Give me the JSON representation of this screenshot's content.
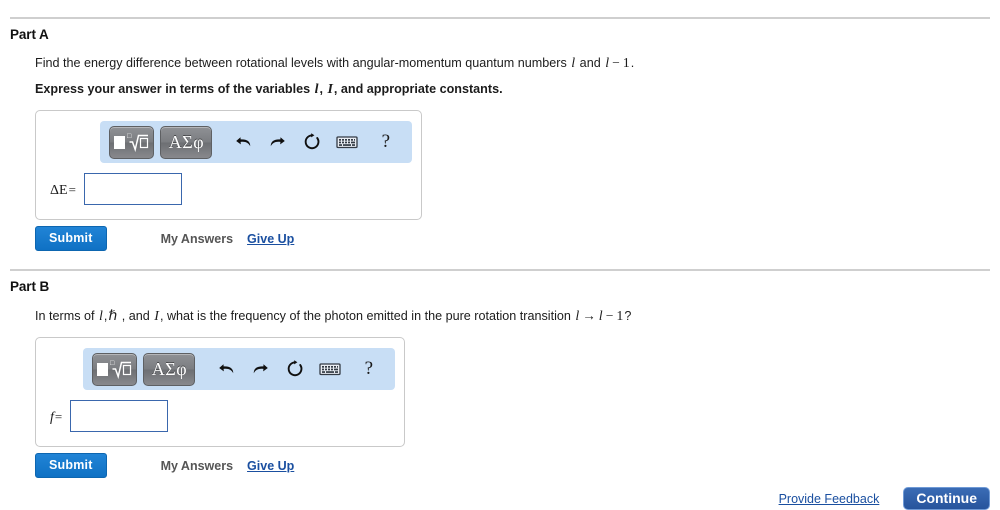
{
  "colors": {
    "toolbar_bg": "#c8def5",
    "submit_blue": "#1177cc",
    "continue_blue": "#2d5ea8",
    "link_blue": "#1a4fa0",
    "divider_gray": "#cfcfcf",
    "template_button_gray": "#7b7d81",
    "input_border_blue": "#3a67ad"
  },
  "parts": {
    "a": {
      "heading": "Part A",
      "question_pre": "Find the energy difference between rotational levels with angular-momentum quantum numbers ",
      "question_var1": "l",
      "question_mid": " and ",
      "question_var2": "l",
      "question_minus": "−",
      "question_one": "1",
      "question_end": ".",
      "instruction_pre": "Express your answer in terms of the variables ",
      "instruction_var1": "l",
      "instruction_comma": ", ",
      "instruction_var2": "I",
      "instruction_end": ", and appropriate constants.",
      "variable_label": "ΔE",
      "equals": "=",
      "answer_value": "",
      "submit_label": "Submit",
      "my_answers_label": "My Answers",
      "give_up_label": "Give Up"
    },
    "b": {
      "heading": "Part B",
      "question_pre": "In terms of ",
      "question_var1": "l",
      "question_comma1": ",",
      "question_var2": "ℏ",
      "question_mid": " , and ",
      "question_var3": "I",
      "question_mid2": ", what is the frequency of the photon emitted in the pure rotation transition ",
      "question_var4": "l",
      "question_arrow": "→",
      "question_var5": "l",
      "question_minus": "−",
      "question_one": "1",
      "question_end": "?",
      "variable_label": "f",
      "equals": "=",
      "answer_value": "",
      "submit_label": "Submit",
      "my_answers_label": "My Answers",
      "give_up_label": "Give Up"
    }
  },
  "mathbar": {
    "template_button_label": "",
    "greek_button_label": "ΑΣφ",
    "undo_label": "",
    "redo_label": "",
    "reset_label": "",
    "keyboard_label": "",
    "help_label": "?"
  },
  "footer": {
    "provide_feedback_label": "Provide Feedback",
    "continue_label": "Continue"
  }
}
